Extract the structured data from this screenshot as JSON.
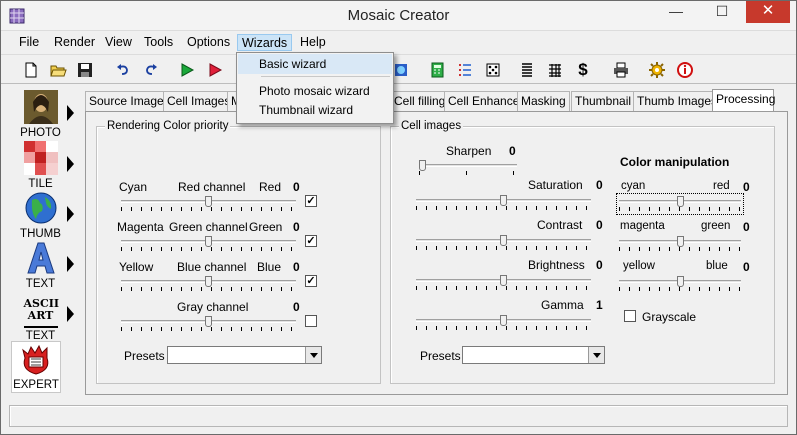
{
  "window": {
    "title": "Mosaic Creator",
    "controls": {
      "minimize": "—",
      "maximize": "☐",
      "close": "✕"
    }
  },
  "menu": [
    "File",
    "Render",
    "View",
    "Tools",
    "Options",
    "Wizards",
    "Help"
  ],
  "wizards_menu": {
    "items": [
      "Basic wizard",
      "Photo mosaic wizard",
      "Thumbnail wizard"
    ]
  },
  "sidebar": {
    "items": [
      "PHOTO",
      "TILE",
      "THUMB",
      "TEXT",
      "TEXT",
      "EXPERT"
    ],
    "ascii_logo": "ASCII ART"
  },
  "tabs": [
    "Source Image",
    "Cell Images",
    "M",
    "Cell filling",
    "Cell Enhance",
    "Masking",
    "Thumbnail",
    "Thumb Images",
    "Processing"
  ],
  "rendering": {
    "title": "Rendering Color priority",
    "rows": [
      {
        "left": "Cyan",
        "mid": "Red channel",
        "right": "Red",
        "value": "0",
        "checked": "✓",
        "position": 0.5
      },
      {
        "left": "Magenta",
        "mid": "Green channel",
        "right": "Green",
        "value": "0",
        "checked": "✓",
        "position": 0.5
      },
      {
        "left": "Yellow",
        "mid": "Blue channel",
        "right": "Blue",
        "value": "0",
        "checked": "✓",
        "position": 0.5
      },
      {
        "left": "",
        "mid": "Gray channel",
        "right": "",
        "value": "0",
        "checked": "",
        "position": 0.5
      }
    ],
    "presets_label": "Presets"
  },
  "cell_images": {
    "title": "Cell images",
    "sharpen": {
      "label": "Sharpen",
      "value": "0"
    },
    "rows": [
      {
        "label": "Saturation",
        "value": "0",
        "position": 0.5
      },
      {
        "label": "Contrast",
        "value": "0",
        "position": 0.5
      },
      {
        "label": "Brightness",
        "value": "0",
        "position": 0.5
      },
      {
        "label": "Gamma",
        "value": "1",
        "position": 0.5
      }
    ],
    "presets_label": "Presets"
  },
  "color_manipulation": {
    "title": "Color manipulation",
    "rows": [
      {
        "left": "cyan",
        "right": "red",
        "value": "0",
        "position": 0.5
      },
      {
        "left": "magenta",
        "right": "green",
        "value": "0",
        "position": 0.5
      },
      {
        "left": "yellow",
        "right": "blue",
        "value": "0",
        "position": 0.5
      }
    ],
    "grayscale_label": "Grayscale"
  },
  "colors": {
    "accent_close": "#c7392c",
    "menu_highlight": "#cce4f7"
  }
}
